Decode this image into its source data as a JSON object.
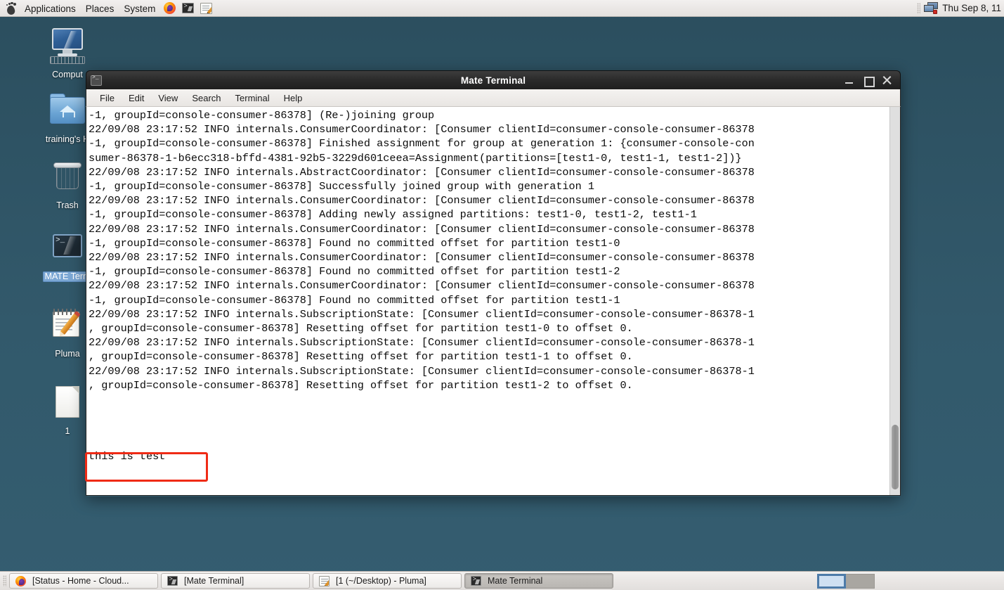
{
  "top_panel": {
    "logo_icon": "gnome-foot-icon",
    "menus": [
      "Applications",
      "Places",
      "System"
    ],
    "launchers": [
      {
        "name": "firefox-launcher-icon",
        "label": "Firefox"
      },
      {
        "name": "terminal-launcher-icon",
        "label": "Mate Terminal"
      },
      {
        "name": "pluma-launcher-icon",
        "label": "Pluma"
      }
    ],
    "tray": {
      "network_icon": "network-monitor-icon",
      "clock": "Thu Sep  8, 11"
    }
  },
  "desktop": {
    "icons": [
      {
        "name": "computer",
        "icon": "computer-icon",
        "label": "Comput",
        "selected": false
      },
      {
        "name": "home",
        "icon": "home-folder-icon",
        "label": "training's H",
        "selected": false
      },
      {
        "name": "trash",
        "icon": "trash-icon",
        "label": "Trash",
        "selected": false
      },
      {
        "name": "mate-terminal",
        "icon": "terminal-icon",
        "label": "MATE Term",
        "selected": true
      },
      {
        "name": "pluma",
        "icon": "pluma-icon",
        "label": "Pluma",
        "selected": false
      },
      {
        "name": "file-1",
        "icon": "document-icon",
        "label": "1",
        "selected": false
      }
    ]
  },
  "terminal_window": {
    "title": "Mate Terminal",
    "window_icon": "terminal-window-icon",
    "controls": {
      "minimize": "minimize-icon",
      "maximize": "maximize-icon",
      "close": "close-icon"
    },
    "menubar": [
      "File",
      "Edit",
      "View",
      "Search",
      "Terminal",
      "Help"
    ],
    "content": "-1, groupId=console-consumer-86378] (Re-)joining group\n22/09/08 23:17:52 INFO internals.ConsumerCoordinator: [Consumer clientId=consumer-console-consumer-86378\n-1, groupId=console-consumer-86378] Finished assignment for group at generation 1: {consumer-console-con\nsumer-86378-1-b6ecc318-bffd-4381-92b5-3229d601ceea=Assignment(partitions=[test1-0, test1-1, test1-2])}\n22/09/08 23:17:52 INFO internals.AbstractCoordinator: [Consumer clientId=consumer-console-consumer-86378\n-1, groupId=console-consumer-86378] Successfully joined group with generation 1\n22/09/08 23:17:52 INFO internals.ConsumerCoordinator: [Consumer clientId=consumer-console-consumer-86378\n-1, groupId=console-consumer-86378] Adding newly assigned partitions: test1-0, test1-2, test1-1\n22/09/08 23:17:52 INFO internals.ConsumerCoordinator: [Consumer clientId=consumer-console-consumer-86378\n-1, groupId=console-consumer-86378] Found no committed offset for partition test1-0\n22/09/08 23:17:52 INFO internals.ConsumerCoordinator: [Consumer clientId=consumer-console-consumer-86378\n-1, groupId=console-consumer-86378] Found no committed offset for partition test1-2\n22/09/08 23:17:52 INFO internals.ConsumerCoordinator: [Consumer clientId=consumer-console-consumer-86378\n-1, groupId=console-consumer-86378] Found no committed offset for partition test1-1\n22/09/08 23:17:52 INFO internals.SubscriptionState: [Consumer clientId=consumer-console-consumer-86378-1\n, groupId=console-consumer-86378] Resetting offset for partition test1-0 to offset 0.\n22/09/08 23:17:52 INFO internals.SubscriptionState: [Consumer clientId=consumer-console-consumer-86378-1\n, groupId=console-consumer-86378] Resetting offset for partition test1-1 to offset 0.\n22/09/08 23:17:52 INFO internals.SubscriptionState: [Consumer clientId=consumer-console-consumer-86378-1\n, groupId=console-consumer-86378] Resetting offset for partition test1-2 to offset 0.\n\n\n\n\nthis is test",
    "annotation": {
      "name": "red-highlight-box",
      "color": "#ef2b16",
      "target_text": "this is test"
    }
  },
  "bottom_panel": {
    "tasks": [
      {
        "name": "taskbar-item-firefox",
        "icon": "firefox-icon",
        "label": "[Status - Home - Cloud...",
        "active": false
      },
      {
        "name": "taskbar-item-mate-terminal-1",
        "icon": "terminal-icon",
        "label": "[Mate Terminal]",
        "active": false
      },
      {
        "name": "taskbar-item-pluma",
        "icon": "pluma-icon",
        "label": "[1 (~/Desktop) - Pluma]",
        "active": false
      },
      {
        "name": "taskbar-item-mate-terminal-2",
        "icon": "terminal-icon",
        "label": "Mate Terminal",
        "active": true
      }
    ],
    "workspaces": [
      {
        "name": "workspace-1",
        "active": true
      },
      {
        "name": "workspace-2",
        "active": false
      }
    ]
  }
}
